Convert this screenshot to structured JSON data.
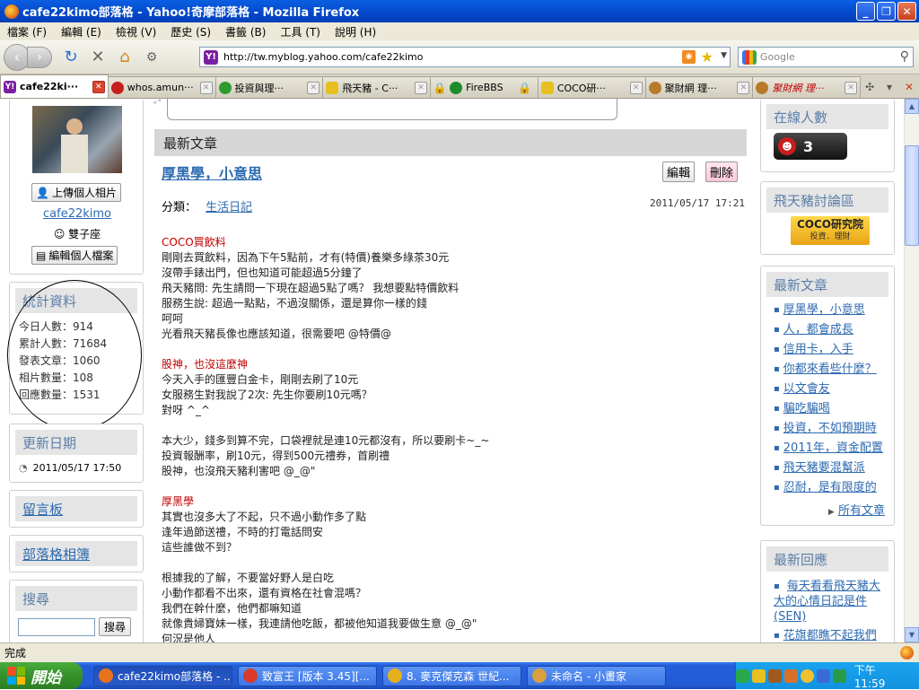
{
  "window": {
    "title": "cafe22kimo部落格 - Yahoo!奇摩部落格 - Mozilla Firefox"
  },
  "menu": [
    "檔案 (F)",
    "編輯 (E)",
    "檢視 (V)",
    "歷史 (S)",
    "書籤 (B)",
    "工具 (T)",
    "說明 (H)"
  ],
  "nav": {
    "url": "http://tw.myblog.yahoo.com/cafe22kimo",
    "search_placeholder": "Google"
  },
  "tabs": [
    {
      "label": "cafe22ki···",
      "color": "#7a1fa2",
      "icon_text": "Y!"
    },
    {
      "label": "whos.amun···",
      "color": "#c81e1e",
      "icon_text": ""
    },
    {
      "label": "投資與理···",
      "color": "#2f9a2f",
      "icon_text": ""
    },
    {
      "label": "飛天豬 - C···",
      "color": "#e6c020",
      "icon_text": ""
    },
    {
      "label": "FireBBS",
      "color": "#1c8c2c",
      "icon_text": ""
    },
    {
      "label": "COCO研···",
      "color": "#e6c020",
      "icon_text": ""
    },
    {
      "label": "聚財網 理···",
      "color": "#b87a2a",
      "icon_text": ""
    },
    {
      "label": "聚財網 理···",
      "color": "#b87a2a",
      "icon_text": ""
    }
  ],
  "left": {
    "upload_photo": "上傳個人相片",
    "username": "cafe22kimo",
    "zodiac": "雙子座",
    "edit_profile": "編輯個人檔案",
    "stats_title": "統計資料",
    "stats": [
      "今日人數：914",
      "累計人數：71684",
      "發表文章：1060",
      "相片數量：108",
      "回應數量：1531"
    ],
    "updated_title": "更新日期",
    "updated_date": "2011/05/17 17:50",
    "guestbook": "留言板",
    "album": "部落格相簿",
    "search_title": "搜尋",
    "search_button": "搜尋"
  },
  "main": {
    "header": "最新文章",
    "post_title": "厚黑學，小意思",
    "edit_button": "編輯",
    "delete_button": "刪除",
    "category_label": "分類：",
    "category": "生活日記",
    "date": "2011/05/17 17:21",
    "body": [
      {
        "t": "COCO買飲料",
        "s": true
      },
      {
        "t": "剛剛去買飲料，因為下午5點前，才有(特價)養樂多綠茶30元"
      },
      {
        "t": "沒帶手錶出門，但也知道可能超過5分鐘了"
      },
      {
        "t": "飛天豬問: 先生請問一下現在超過5點了嗎？ 我想要點特價飲料"
      },
      {
        "t": "服務生說: 超過一點點，不過沒關係，還是算你一樣的錢"
      },
      {
        "t": "呵呵"
      },
      {
        "t": "光看飛天豬長像也應該知道，很需要吧 @特價@"
      },
      {
        "t": ""
      },
      {
        "t": "股神，也沒這麼神",
        "s": true
      },
      {
        "t": "今天入手的匯豐白金卡，剛剛去刷了10元"
      },
      {
        "t": "女服務生對我說了2次: 先生你要刷10元嗎？"
      },
      {
        "t": "對呀 ^_^"
      },
      {
        "t": ""
      },
      {
        "t": "本大少，錢多到算不完，口袋裡就是連10元都沒有，所以要刷卡~_~"
      },
      {
        "t": "投資報酬率，刷10元，得到500元禮券，首刷禮"
      },
      {
        "t": "股神，也沒飛天豬利害吧 @_@\""
      },
      {
        "t": ""
      },
      {
        "t": "厚黑學",
        "s": true
      },
      {
        "t": "其實也沒多大了不起，只不過小動作多了點"
      },
      {
        "t": "逢年過節送禮，不時的打電話問安"
      },
      {
        "t": "這些誰做不到？"
      },
      {
        "t": ""
      },
      {
        "t": "根據我的了解，不要當好野人是白吃"
      },
      {
        "t": "小動作都看不出來，還有資格在社會混嗎？"
      },
      {
        "t": "我們在幹什麼，他們都嘛知道"
      },
      {
        "t": "就像貴婦寶妹一樣，我連請他吃飯，都被他知道我要做生意 @_@\""
      },
      {
        "t": "何況是他人"
      }
    ]
  },
  "right": {
    "online_title": "在線人數",
    "online_count": "3",
    "forum_title": "飛天豬討論區",
    "coco_logo": "COCO研究院",
    "coco_sub": "投資．理財",
    "recent_title": "最新文章",
    "recent": [
      "厚黑學，小意思",
      "人，都會成長",
      "信用卡，入手",
      "你都來看些什麼？",
      "以文會友",
      "騙吃騙喝",
      "投資，不如預期時",
      "2011年，資金配置",
      "飛天豬要混幫派",
      "忍耐，是有限度的"
    ],
    "all_posts": "所有文章",
    "replies_title": "最新回應",
    "replies": [
      "每天看看飛天豬大大的心情日記是件",
      "(SEN)",
      "花旗都瞧不起我們"
    ]
  },
  "status": "完成",
  "taskbar": {
    "start": "開始",
    "tasks": [
      {
        "label": "cafe22kimo部落格 - ...",
        "color": "#e8731c"
      },
      {
        "label": "致富王 [版本 3.45][...",
        "color": "#d93a2a"
      },
      {
        "label": "8. 麥克傑克森 世紀...",
        "color": "#e6b020"
      },
      {
        "label": "未命名 - 小畫家",
        "color": "#d9a040"
      }
    ],
    "clock": "下午 11:59"
  },
  "colors": {
    "accent": "#2d6ab0",
    "section_red": "#c00000"
  }
}
